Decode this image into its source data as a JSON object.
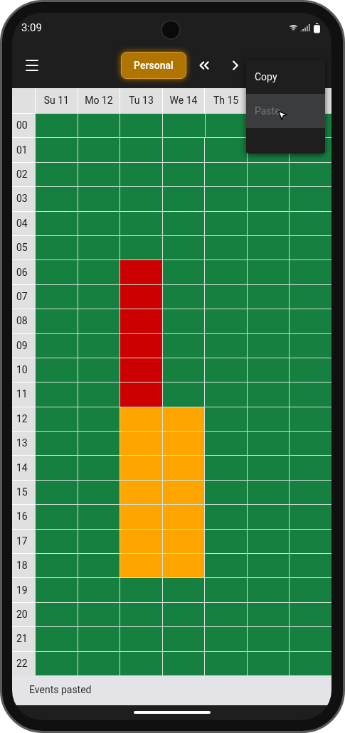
{
  "status_bar": {
    "time": "3:09"
  },
  "app_bar": {
    "calendar_button": "Personal"
  },
  "menu": {
    "items": [
      {
        "label": "Copy",
        "disabled": false,
        "selected": false
      },
      {
        "label": "Paste",
        "disabled": true,
        "selected": true
      }
    ]
  },
  "grid": {
    "columns": [
      "Su 11",
      "Mo 12",
      "Tu 13",
      "We 14",
      "Th 15"
    ],
    "rows": [
      {
        "hour": "00",
        "cells": [
          {
            "color": "#168040"
          },
          {
            "color": "#168040"
          },
          {
            "color": "#168040"
          },
          {
            "color": "#168040"
          },
          {
            "color": "#168040"
          },
          null,
          {
            "color": "#168040"
          }
        ]
      },
      {
        "hour": "01",
        "cells": [
          {
            "color": "#168040"
          },
          {
            "color": "#168040"
          },
          {
            "color": "#168040"
          },
          {
            "color": "#168040"
          },
          {
            "color": "#168040"
          },
          {
            "color": "#168040"
          },
          {
            "color": "#168040"
          }
        ]
      },
      {
        "hour": "02",
        "cells": [
          {
            "color": "#168040"
          },
          {
            "color": "#168040"
          },
          {
            "color": "#168040"
          },
          {
            "color": "#168040"
          },
          {
            "color": "#168040"
          },
          {
            "color": "#168040"
          },
          {
            "color": "#168040"
          }
        ]
      },
      {
        "hour": "03",
        "cells": [
          {
            "color": "#168040"
          },
          {
            "color": "#168040"
          },
          {
            "color": "#168040"
          },
          {
            "color": "#168040"
          },
          {
            "color": "#168040"
          },
          {
            "color": "#168040"
          },
          {
            "color": "#168040"
          }
        ]
      },
      {
        "hour": "04",
        "cells": [
          {
            "color": "#168040"
          },
          {
            "color": "#168040"
          },
          {
            "color": "#168040"
          },
          {
            "color": "#168040"
          },
          {
            "color": "#168040"
          },
          {
            "color": "#168040"
          },
          {
            "color": "#168040"
          }
        ]
      },
      {
        "hour": "05",
        "cells": [
          {
            "color": "#168040"
          },
          {
            "color": "#168040"
          },
          {
            "color": "#168040"
          },
          {
            "color": "#168040"
          },
          {
            "color": "#168040"
          },
          {
            "color": "#168040"
          },
          {
            "color": "#168040"
          }
        ]
      },
      {
        "hour": "06",
        "cells": [
          {
            "color": "#168040"
          },
          {
            "color": "#168040"
          },
          {
            "color": "#cc0000"
          },
          {
            "color": "#168040"
          },
          {
            "color": "#168040"
          },
          {
            "color": "#168040"
          },
          {
            "color": "#168040"
          }
        ]
      },
      {
        "hour": "07",
        "cells": [
          {
            "color": "#168040"
          },
          {
            "color": "#168040"
          },
          {
            "color": "#cc0000"
          },
          {
            "color": "#168040"
          },
          {
            "color": "#168040"
          },
          {
            "color": "#168040"
          },
          {
            "color": "#168040"
          }
        ]
      },
      {
        "hour": "08",
        "cells": [
          {
            "color": "#168040"
          },
          {
            "color": "#168040"
          },
          {
            "color": "#cc0000"
          },
          {
            "color": "#168040"
          },
          {
            "color": "#168040"
          },
          {
            "color": "#168040"
          },
          {
            "color": "#168040"
          }
        ]
      },
      {
        "hour": "09",
        "cells": [
          {
            "color": "#168040"
          },
          {
            "color": "#168040"
          },
          {
            "color": "#cc0000"
          },
          {
            "color": "#168040"
          },
          {
            "color": "#168040"
          },
          {
            "color": "#168040"
          },
          {
            "color": "#168040"
          }
        ]
      },
      {
        "hour": "10",
        "cells": [
          {
            "color": "#168040"
          },
          {
            "color": "#168040"
          },
          {
            "color": "#cc0000"
          },
          {
            "color": "#168040"
          },
          {
            "color": "#168040"
          },
          {
            "color": "#168040"
          },
          {
            "color": "#168040"
          }
        ]
      },
      {
        "hour": "11",
        "cells": [
          {
            "color": "#168040"
          },
          {
            "color": "#168040"
          },
          {
            "color": "#cc0000"
          },
          {
            "color": "#168040"
          },
          {
            "color": "#168040"
          },
          {
            "color": "#168040"
          },
          {
            "color": "#168040"
          }
        ]
      },
      {
        "hour": "12",
        "cells": [
          {
            "color": "#168040"
          },
          {
            "color": "#168040"
          },
          {
            "color": "#ffa500"
          },
          {
            "color": "#ffa500"
          },
          {
            "color": "#168040"
          },
          {
            "color": "#168040"
          },
          {
            "color": "#168040"
          }
        ]
      },
      {
        "hour": "13",
        "cells": [
          {
            "color": "#168040"
          },
          {
            "color": "#168040"
          },
          {
            "color": "#ffa500"
          },
          {
            "color": "#ffa500"
          },
          {
            "color": "#168040"
          },
          {
            "color": "#168040"
          },
          {
            "color": "#168040"
          }
        ]
      },
      {
        "hour": "14",
        "cells": [
          {
            "color": "#168040"
          },
          {
            "color": "#168040"
          },
          {
            "color": "#ffa500"
          },
          {
            "color": "#ffa500"
          },
          {
            "color": "#168040"
          },
          {
            "color": "#168040"
          },
          {
            "color": "#168040"
          }
        ]
      },
      {
        "hour": "15",
        "cells": [
          {
            "color": "#168040"
          },
          {
            "color": "#168040"
          },
          {
            "color": "#ffa500"
          },
          {
            "color": "#ffa500"
          },
          {
            "color": "#168040"
          },
          {
            "color": "#168040"
          },
          {
            "color": "#168040"
          }
        ]
      },
      {
        "hour": "16",
        "cells": [
          {
            "color": "#168040"
          },
          {
            "color": "#168040"
          },
          {
            "color": "#ffa500"
          },
          {
            "color": "#ffa500"
          },
          {
            "color": "#168040"
          },
          {
            "color": "#168040"
          },
          {
            "color": "#168040"
          }
        ]
      },
      {
        "hour": "17",
        "cells": [
          {
            "color": "#168040"
          },
          {
            "color": "#168040"
          },
          {
            "color": "#ffa500"
          },
          {
            "color": "#ffa500"
          },
          {
            "color": "#168040"
          },
          {
            "color": "#168040"
          },
          {
            "color": "#168040"
          }
        ]
      },
      {
        "hour": "18",
        "cells": [
          {
            "color": "#168040"
          },
          {
            "color": "#168040"
          },
          {
            "color": "#ffa500"
          },
          {
            "color": "#ffa500"
          },
          {
            "color": "#168040"
          },
          {
            "color": "#168040"
          },
          {
            "color": "#168040"
          }
        ]
      },
      {
        "hour": "19",
        "cells": [
          {
            "color": "#168040"
          },
          {
            "color": "#168040"
          },
          {
            "color": "#168040"
          },
          {
            "color": "#168040"
          },
          {
            "color": "#168040"
          },
          {
            "color": "#168040"
          },
          {
            "color": "#168040"
          }
        ]
      },
      {
        "hour": "20",
        "cells": [
          {
            "color": "#168040"
          },
          {
            "color": "#168040"
          },
          {
            "color": "#168040"
          },
          {
            "color": "#168040"
          },
          {
            "color": "#168040"
          },
          {
            "color": "#168040"
          },
          {
            "color": "#168040"
          }
        ]
      },
      {
        "hour": "21",
        "cells": [
          {
            "color": "#168040"
          },
          {
            "color": "#168040"
          },
          {
            "color": "#168040"
          },
          {
            "color": "#168040"
          },
          {
            "color": "#168040"
          },
          {
            "color": "#168040"
          },
          {
            "color": "#168040"
          }
        ]
      },
      {
        "hour": "22",
        "cells": [
          {
            "color": "#168040"
          },
          {
            "color": "#168040"
          },
          {
            "color": "#168040"
          },
          {
            "color": "#168040"
          },
          {
            "color": "#168040"
          },
          {
            "color": "#168040"
          },
          {
            "color": "#168040"
          }
        ]
      }
    ]
  },
  "snackbar": {
    "message": "Events pasted"
  }
}
